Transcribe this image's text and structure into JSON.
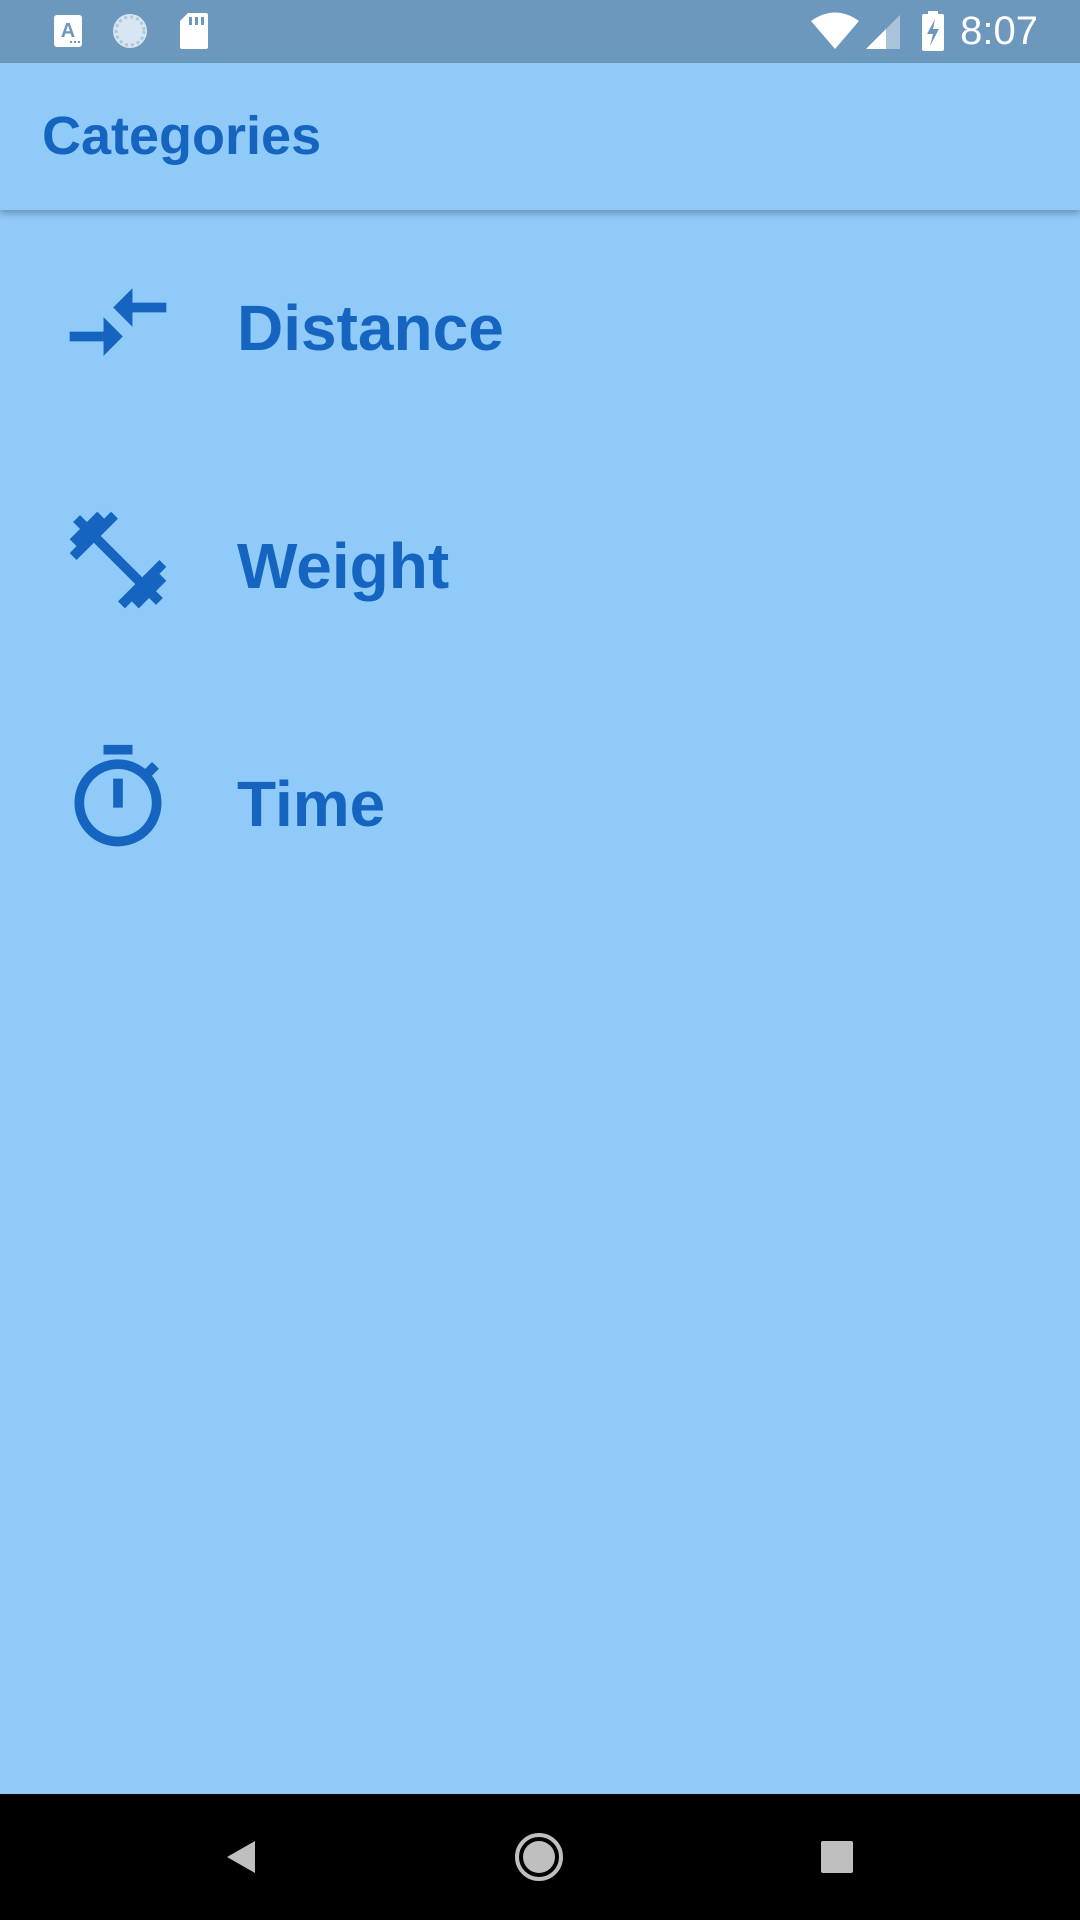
{
  "status_bar": {
    "time": "8:07",
    "left_icons": [
      "text-a-notification-icon",
      "sync-circle-icon",
      "sd-card-icon"
    ],
    "right_icons": [
      "wifi-icon",
      "cell-signal-icon",
      "battery-charging-icon"
    ]
  },
  "app_bar": {
    "title": "Categories"
  },
  "categories": [
    {
      "label": "Distance",
      "icon": "compare-arrows-icon"
    },
    {
      "label": "Weight",
      "icon": "fitness-center-icon"
    },
    {
      "label": "Time",
      "icon": "timer-icon"
    }
  ],
  "navigation_bar": {
    "buttons": [
      "back-icon",
      "home-icon",
      "recents-icon"
    ]
  },
  "colors": {
    "background": "#90caf9",
    "status_bar": "#6d98bd",
    "accent": "#1565c0",
    "nav_bar": "#000000"
  }
}
